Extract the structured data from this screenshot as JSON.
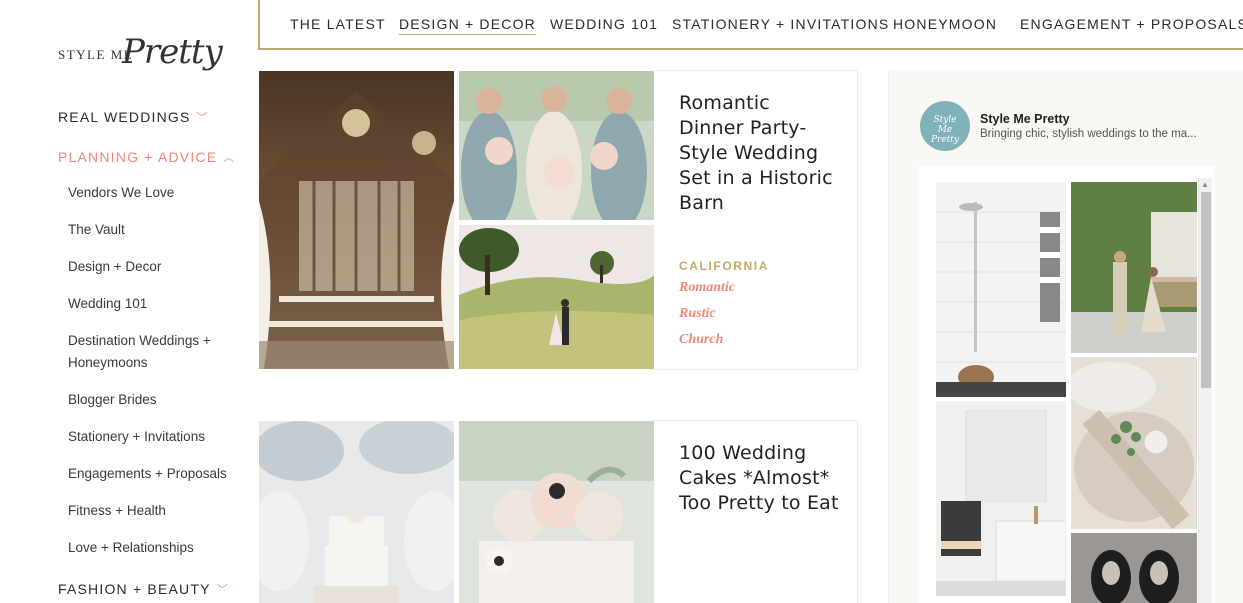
{
  "logo": {
    "small": "STYLE ME",
    "script": "Pretty"
  },
  "sidebar": {
    "top_items": [
      {
        "label": "REAL WEDDINGS"
      },
      {
        "label": "PLANNING + ADVICE"
      },
      {
        "label": "FASHION + BEAUTY"
      }
    ],
    "sub_items": [
      "Vendors We Love",
      "The Vault",
      "Design + Decor",
      "Wedding 101",
      "Destination Weddings + Honeymoons",
      "Blogger Brides",
      "Stationery + Invitations",
      "Engagements + Proposals",
      "Fitness + Health",
      "Love + Relationships"
    ]
  },
  "topnav": {
    "tabs": [
      "THE LATEST",
      "DESIGN + DECOR",
      "WEDDING 101",
      "STATIONERY + INVITATIONS",
      "HONEYMOON",
      "ENGAGEMENT + PROPOSALS"
    ]
  },
  "posts": [
    {
      "title": "Romantic Dinner Party-Style Wedding Set in a Historic Barn",
      "location": "CALIFORNIA",
      "tags": [
        "Romantic",
        "Rustic",
        "Church"
      ]
    },
    {
      "title": "100 Wedding Cakes *Almost* Too Pretty to Eat"
    }
  ],
  "widget": {
    "name": "Style Me Pretty",
    "description": "Bringing chic, stylish weddings to the ma...",
    "avatar_text": "Style Me Pretty"
  },
  "icons": {
    "chevron_down": "chevron-down-icon",
    "chevron_up": "chevron-up-icon",
    "scroll_up": "arrow-up-icon"
  },
  "colors": {
    "accent_coral": "#f0877c",
    "accent_gold": "#bfa874",
    "location_gold": "#c7a969",
    "avatar_teal": "#7fb2b9"
  }
}
